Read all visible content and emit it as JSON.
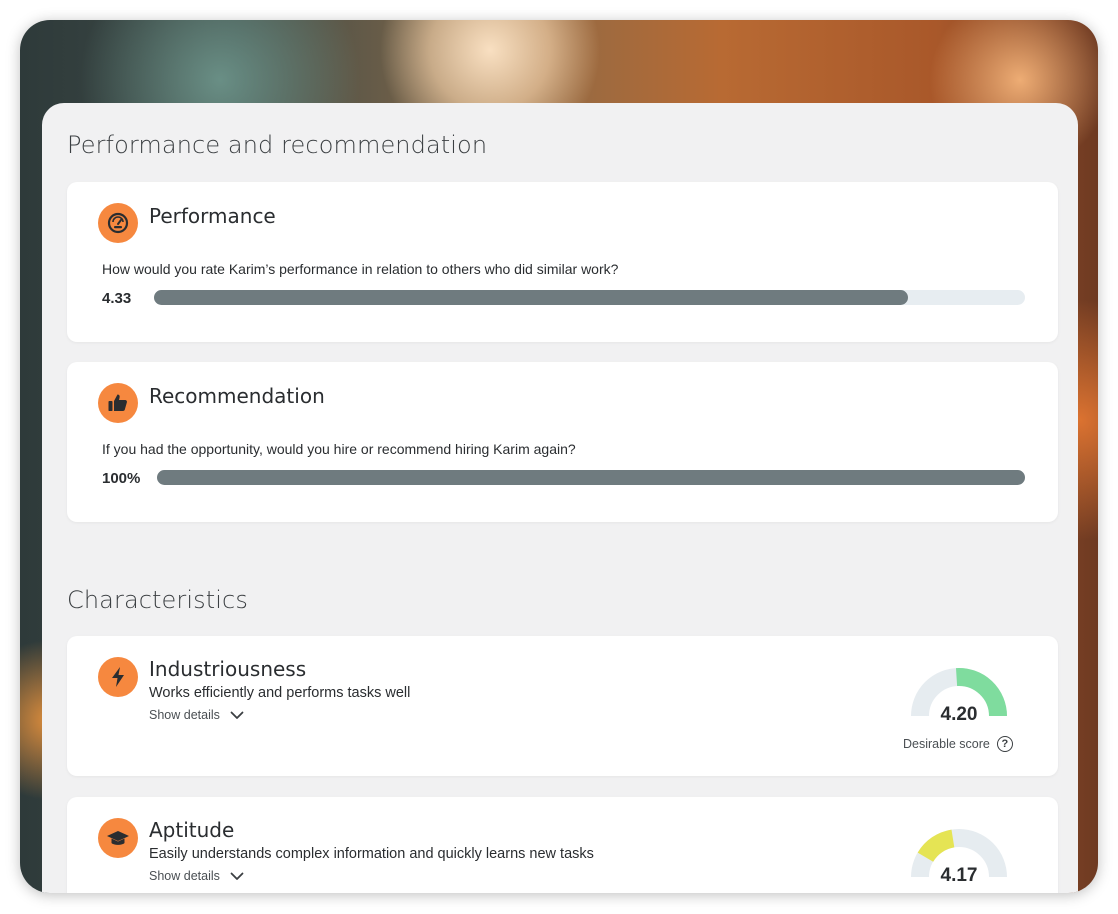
{
  "performance_section": {
    "title": "Performance and recommendation",
    "performance": {
      "icon": "gauge-face-icon",
      "title": "Performance",
      "question": "How would you rate Karim’s performance in relation to others who did similar work?",
      "value_label": "4.33",
      "fill_fraction": 0.866
    },
    "recommendation": {
      "icon": "thumbs-up-icon",
      "title": "Recommendation",
      "question": "If you had the opportunity, would you hire or recommend hiring Karim again?",
      "value_label": "100%",
      "fill_fraction": 1.0
    }
  },
  "characteristics_section": {
    "title": "Characteristics",
    "items": [
      {
        "icon": "lightning-bolt-icon",
        "title": "Industriousness",
        "description": "Works efficiently and performs tasks well",
        "show_details": "Show details",
        "score": "4.20",
        "score_color": "#7fdc9e",
        "score_caption": "Desirable score",
        "help_glyph": "?"
      },
      {
        "icon": "graduation-cap-icon",
        "title": "Aptitude",
        "description": "Easily understands complex information and quickly learns new tasks",
        "show_details": "Show details",
        "score": "4.17",
        "score_color": "#e5e454"
      }
    ]
  },
  "colors": {
    "accent_orange": "#f6883f",
    "bar_fill": "#6f7b7f",
    "bar_track": "#e7edf1",
    "gauge_track": "#e6ecf0"
  }
}
